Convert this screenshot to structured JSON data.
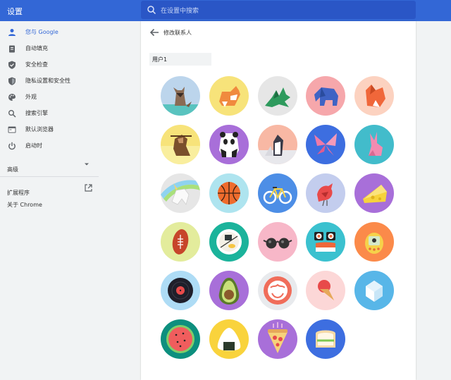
{
  "header": {
    "app_title": "设置",
    "search_placeholder": "在设置中搜索"
  },
  "sidebar": {
    "items": [
      {
        "label": "您与 Google",
        "icon": "person-icon",
        "active": true
      },
      {
        "label": "自动填充",
        "icon": "clipboard-icon",
        "active": false
      },
      {
        "label": "安全检查",
        "icon": "shield-check-icon",
        "active": false
      },
      {
        "label": "隐私设置和安全性",
        "icon": "shield-icon",
        "active": false
      },
      {
        "label": "外观",
        "icon": "palette-icon",
        "active": false
      },
      {
        "label": "搜索引擎",
        "icon": "search-icon",
        "active": false
      },
      {
        "label": "默认浏览器",
        "icon": "browser-icon",
        "active": false
      },
      {
        "label": "启动时",
        "icon": "power-icon",
        "active": false
      }
    ],
    "advanced_label": "高级",
    "extensions_label": "扩展程序",
    "about_label": "关于 Chrome"
  },
  "main": {
    "title": "修改联系人",
    "name_value": "用户1",
    "avatars": [
      {
        "name": "origami-cat",
        "bg": "#bcd5ec"
      },
      {
        "name": "origami-corgi",
        "bg": "#f7e37a"
      },
      {
        "name": "origami-dragon",
        "bg": "#e6e6e6"
      },
      {
        "name": "origami-elephant",
        "bg": "#f6a7ab"
      },
      {
        "name": "origami-fox",
        "bg": "#fcd2c0"
      },
      {
        "name": "origami-monkey",
        "bg": "#f7e37a"
      },
      {
        "name": "origami-panda",
        "bg": "#a86fd9"
      },
      {
        "name": "origami-penguin",
        "bg": "#f8b8a4"
      },
      {
        "name": "origami-butterfly",
        "bg": "#3d6ee0"
      },
      {
        "name": "origami-rabbit",
        "bg": "#42bccb"
      },
      {
        "name": "origami-unicorn",
        "bg": "#e6e6e6"
      },
      {
        "name": "basketball",
        "bg": "#aee4ef"
      },
      {
        "name": "bicycle",
        "bg": "#4d8ee6"
      },
      {
        "name": "bird",
        "bg": "#c3cdee"
      },
      {
        "name": "cheese",
        "bg": "#a86fd9"
      },
      {
        "name": "football",
        "bg": "#e3ec9c"
      },
      {
        "name": "ramen-bowl",
        "bg": "#1bb39b"
      },
      {
        "name": "sunglasses",
        "bg": "#f7b7c8"
      },
      {
        "name": "sushi",
        "bg": "#3bc1cf"
      },
      {
        "name": "tamagotchi",
        "bg": "#fb8a4a"
      },
      {
        "name": "vinyl-record",
        "bg": "#aedcf5"
      },
      {
        "name": "avocado",
        "bg": "#a86fd9"
      },
      {
        "name": "smiley",
        "bg": "#e8eaed"
      },
      {
        "name": "ice-cream",
        "bg": "#fcd7d7"
      },
      {
        "name": "ice-cube",
        "bg": "#58b6e8"
      },
      {
        "name": "watermelon",
        "bg": "#0d8f7e"
      },
      {
        "name": "onigiri",
        "bg": "#f9d33c"
      },
      {
        "name": "pizza",
        "bg": "#a86fd9"
      },
      {
        "name": "sandwich",
        "bg": "#3d6ee0"
      }
    ]
  },
  "colors": {
    "accent": "#3367d6",
    "search_bg": "#2a56c6",
    "sidebar_bg": "#f1f3f4"
  }
}
